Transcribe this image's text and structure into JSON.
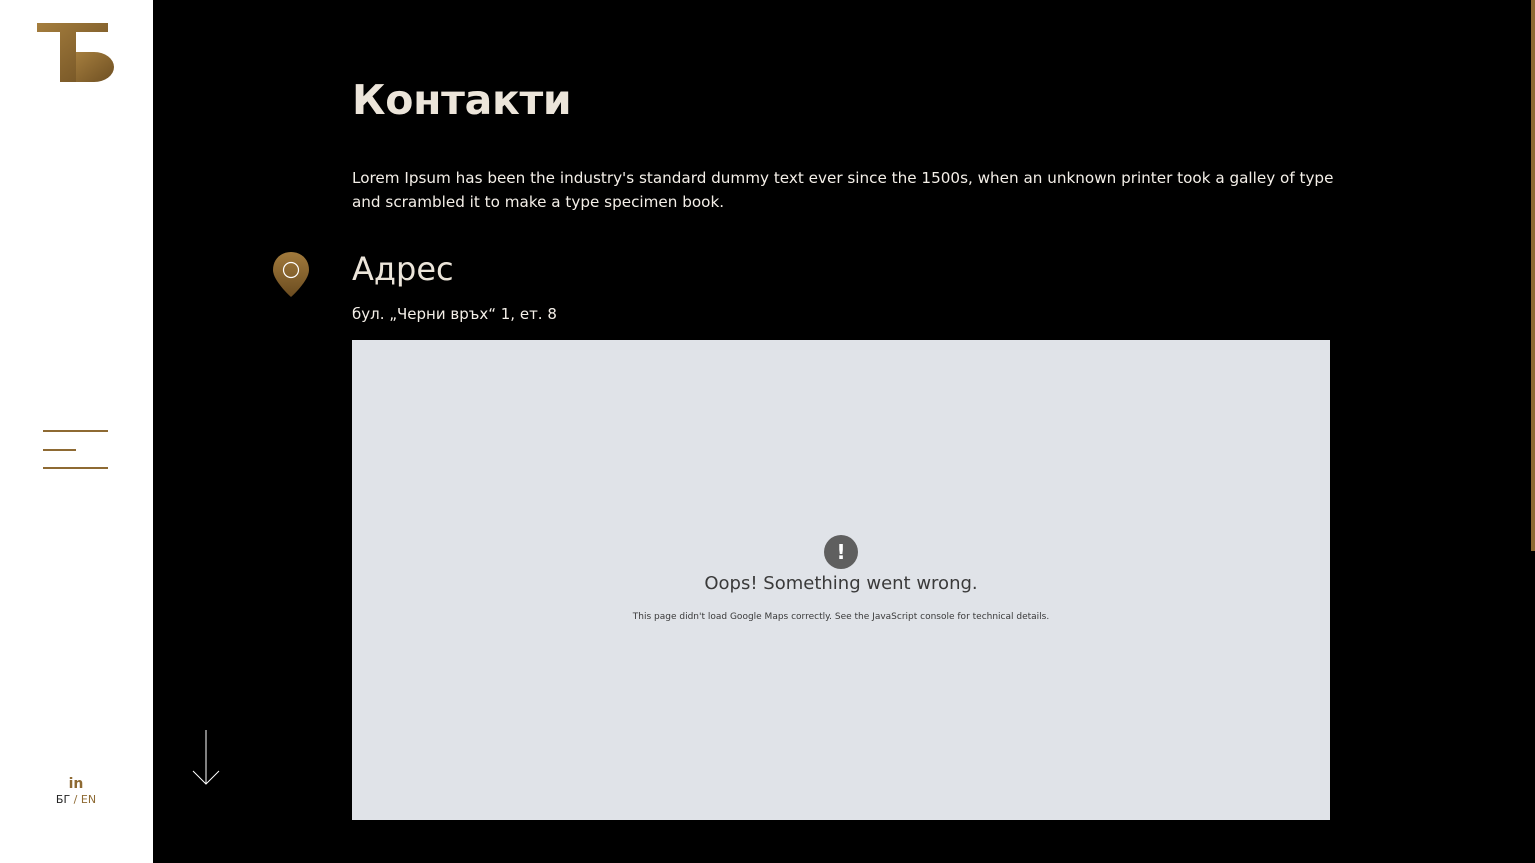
{
  "colors": {
    "accent": "#8e6a33",
    "background": "#000000",
    "sidebar": "#ffffff",
    "map_bg": "#e0e3e8"
  },
  "sidebar": {
    "logo_icon": "tb-logo",
    "menu_icon": "hamburger-icon",
    "social": {
      "icon": "linkedin-icon",
      "label": "in"
    },
    "lang": {
      "bg": "БГ",
      "sep": "/",
      "en": "EN"
    },
    "scroll_icon": "arrow-down-icon"
  },
  "main": {
    "title": "Контакти",
    "intro": "Lorem Ipsum has been the industry's standard dummy text ever since the 1500s, when an unknown printer took a galley of type and scrambled it to make a type specimen book.",
    "address": {
      "icon": "location-pin-icon",
      "heading": "Адрес",
      "text": "бул. „Черни връх“ 1, ет. 8"
    },
    "map": {
      "error_icon": "!",
      "error_title": "Oops! Something went wrong.",
      "error_desc": "This page didn't load Google Maps correctly. See the JavaScript console for technical details."
    }
  }
}
